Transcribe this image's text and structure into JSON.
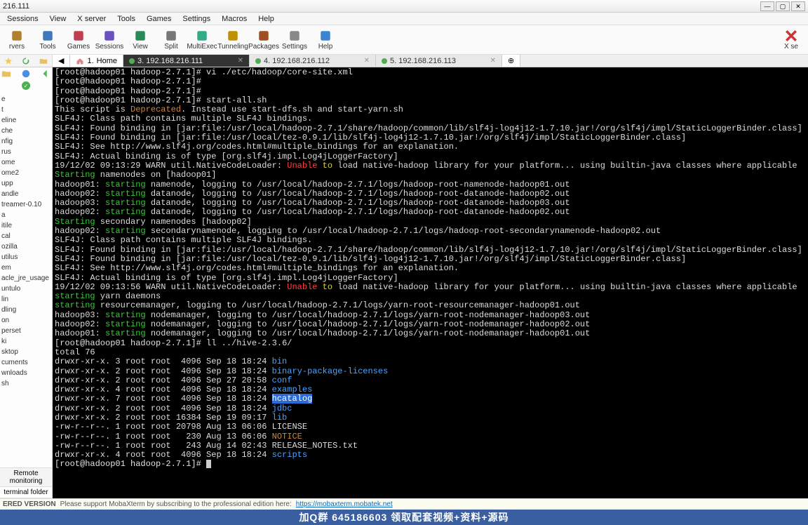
{
  "title_bar": {
    "title": "216.111"
  },
  "menu": {
    "items": [
      "Sessions",
      "View",
      "X server",
      "Tools",
      "Games",
      "Settings",
      "Macros",
      "Help"
    ]
  },
  "toolbar": {
    "items": [
      {
        "label": "rvers"
      },
      {
        "label": "Tools"
      },
      {
        "label": "Games"
      },
      {
        "label": "Sessions"
      },
      {
        "label": "View"
      },
      {
        "label": "Split"
      },
      {
        "label": "MultiExec"
      },
      {
        "label": "Tunneling"
      },
      {
        "label": "Packages"
      },
      {
        "label": "Settings"
      },
      {
        "label": "Help"
      }
    ],
    "right": {
      "label": "X se"
    }
  },
  "tabs": {
    "home": {
      "num": "1.",
      "label": "Home"
    },
    "list": [
      {
        "num": "3.",
        "label": "192.168.216.111",
        "active": true
      },
      {
        "num": "4.",
        "label": "192.168.216.112",
        "active": false
      },
      {
        "num": "5.",
        "label": "192.168.216.113",
        "active": false
      }
    ]
  },
  "sidebar": {
    "remote": "Remote\nmonitoring",
    "bottom": "terminal folder",
    "tree": [
      "e",
      "t",
      "eline",
      "che",
      "nfig",
      "rus",
      "ome",
      "ome2",
      "upp",
      "andle",
      "treamer-0.10",
      "a",
      "itile",
      "cal",
      "ozilla",
      "utilus",
      "em",
      "acle_jre_usage",
      "untulo",
      "lin",
      "dling",
      "on",
      "perset",
      "ki",
      "sktop",
      "cuments",
      "wnloads",
      "sh"
    ]
  },
  "terminal": {
    "lines": [
      {
        "seg": [
          {
            "t": "[root@hadoop01 hadoop-2.7.1]# ",
            "c": "pr"
          },
          {
            "t": "vi ./etc/hadoop/core-site.xml"
          }
        ]
      },
      {
        "seg": [
          {
            "t": "[root@hadoop01 hadoop-2.7.1]# ",
            "c": "pr"
          }
        ]
      },
      {
        "seg": [
          {
            "t": "[root@hadoop01 hadoop-2.7.1]# ",
            "c": "pr"
          }
        ]
      },
      {
        "seg": [
          {
            "t": "[root@hadoop01 hadoop-2.7.1]# ",
            "c": "pr"
          },
          {
            "t": "start-all.sh"
          }
        ]
      },
      {
        "seg": [
          {
            "t": "This script is "
          },
          {
            "t": "Deprecated",
            "c": "orange"
          },
          {
            "t": ". Instead use start-dfs.sh and start-yarn.sh"
          }
        ]
      },
      {
        "seg": [
          {
            "t": "SLF4J: Class path contains multiple SLF4J bindings."
          }
        ]
      },
      {
        "seg": [
          {
            "t": "SLF4J: Found binding in [jar:file:/usr/local/hadoop-2.7.1/share/hadoop/common/lib/slf4j-log4j12-1.7.10.jar!/org/slf4j/impl/StaticLoggerBinder.class]"
          }
        ]
      },
      {
        "seg": [
          {
            "t": "SLF4J: Found binding in [jar:file:/usr/local/tez-0.9.1/lib/slf4j-log4j12-1.7.10.jar!/org/slf4j/impl/StaticLoggerBinder.class]"
          }
        ]
      },
      {
        "seg": [
          {
            "t": "SLF4J: See http://www.slf4j.org/codes.html#multiple_bindings for an explanation."
          }
        ]
      },
      {
        "seg": [
          {
            "t": "SLF4J: Actual binding is of type [org.slf4j.impl.Log4jLoggerFactory]"
          }
        ]
      },
      {
        "seg": [
          {
            "t": "19/12/02 09:13:29 WARN util.NativeCodeLoader: "
          },
          {
            "t": "Unable",
            "c": "red"
          },
          {
            "t": " to",
            "c": "yel"
          },
          {
            "t": " load native-hadoop library for your platform... using builtin-java classes where applicable"
          }
        ]
      },
      {
        "seg": [
          {
            "t": "Starting",
            "c": "green"
          },
          {
            "t": " namenodes on [hadoop01]"
          }
        ]
      },
      {
        "seg": [
          {
            "t": "hadoop01: "
          },
          {
            "t": "starting",
            "c": "green"
          },
          {
            "t": " namenode, logging to /usr/local/hadoop-2.7.1/logs/hadoop-root-namenode-hadoop01.out"
          }
        ]
      },
      {
        "seg": [
          {
            "t": "hadoop02: "
          },
          {
            "t": "starting",
            "c": "green"
          },
          {
            "t": " datanode, logging to /usr/local/hadoop-2.7.1/logs/hadoop-root-datanode-hadoop02.out"
          }
        ]
      },
      {
        "seg": [
          {
            "t": "hadoop03: "
          },
          {
            "t": "starting",
            "c": "green"
          },
          {
            "t": " datanode, logging to /usr/local/hadoop-2.7.1/logs/hadoop-root-datanode-hadoop03.out"
          }
        ]
      },
      {
        "seg": [
          {
            "t": "hadoop02: "
          },
          {
            "t": "starting",
            "c": "green"
          },
          {
            "t": " datanode, logging to /usr/local/hadoop-2.7.1/logs/hadoop-root-datanode-hadoop02.out"
          }
        ]
      },
      {
        "seg": [
          {
            "t": "Starting",
            "c": "green"
          },
          {
            "t": " secondary namenodes [hadoop02]"
          }
        ]
      },
      {
        "seg": [
          {
            "t": "hadoop02: "
          },
          {
            "t": "starting",
            "c": "green"
          },
          {
            "t": " secondarynamenode, logging to /usr/local/hadoop-2.7.1/logs/hadoop-root-secondarynamenode-hadoop02.out"
          }
        ]
      },
      {
        "seg": [
          {
            "t": "SLF4J: Class path contains multiple SLF4J bindings."
          }
        ]
      },
      {
        "seg": [
          {
            "t": "SLF4J: Found binding in [jar:file:/usr/local/hadoop-2.7.1/share/hadoop/common/lib/slf4j-log4j12-1.7.10.jar!/org/slf4j/impl/StaticLoggerBinder.class]"
          }
        ]
      },
      {
        "seg": [
          {
            "t": "SLF4J: Found binding in [jar:file:/usr/local/tez-0.9.1/lib/slf4j-log4j12-1.7.10.jar!/org/slf4j/impl/StaticLoggerBinder.class]"
          }
        ]
      },
      {
        "seg": [
          {
            "t": "SLF4J: See http://www.slf4j.org/codes.html#multiple_bindings for an explanation."
          }
        ]
      },
      {
        "seg": [
          {
            "t": "SLF4J: Actual binding is of type [org.slf4j.impl.Log4jLoggerFactory]"
          }
        ]
      },
      {
        "seg": [
          {
            "t": "19/12/02 09:13:56 WARN util.NativeCodeLoader: "
          },
          {
            "t": "Unable",
            "c": "red"
          },
          {
            "t": " to",
            "c": "yel"
          },
          {
            "t": " load native-hadoop library for your platform... using builtin-java classes where applicable"
          }
        ]
      },
      {
        "seg": [
          {
            "t": "starting",
            "c": "green"
          },
          {
            "t": " yarn daemons"
          }
        ]
      },
      {
        "seg": [
          {
            "t": "starting",
            "c": "green"
          },
          {
            "t": " resourcemanager, logging to /usr/local/hadoop-2.7.1/logs/yarn-root-resourcemanager-hadoop01.out"
          }
        ]
      },
      {
        "seg": [
          {
            "t": "hadoop03: "
          },
          {
            "t": "starting",
            "c": "green"
          },
          {
            "t": " nodemanager, logging to /usr/local/hadoop-2.7.1/logs/yarn-root-nodemanager-hadoop03.out"
          }
        ]
      },
      {
        "seg": [
          {
            "t": "hadoop02: "
          },
          {
            "t": "starting",
            "c": "green"
          },
          {
            "t": " nodemanager, logging to /usr/local/hadoop-2.7.1/logs/yarn-root-nodemanager-hadoop02.out"
          }
        ]
      },
      {
        "seg": [
          {
            "t": "hadoop01: "
          },
          {
            "t": "starting",
            "c": "green"
          },
          {
            "t": " nodemanager, logging to /usr/local/hadoop-2.7.1/logs/yarn-root-nodemanager-hadoop01.out"
          }
        ]
      },
      {
        "seg": [
          {
            "t": "[root@hadoop01 hadoop-2.7.1]# ",
            "c": "pr"
          },
          {
            "t": "ll ../hive-2.3.6/"
          }
        ]
      },
      {
        "seg": [
          {
            "t": "total 76"
          }
        ]
      },
      {
        "seg": [
          {
            "t": "drwxr-xr-x. 3 root root  4096 Sep 18 18:24 "
          },
          {
            "t": "bin",
            "c": "blue"
          }
        ]
      },
      {
        "seg": [
          {
            "t": "drwxr-xr-x. 2 root root  4096 Sep 18 18:24 "
          },
          {
            "t": "binary-package-licenses",
            "c": "blue"
          }
        ]
      },
      {
        "seg": [
          {
            "t": "drwxr-xr-x. 2 root root  4096 Sep 27 20:58 "
          },
          {
            "t": "conf",
            "c": "blue"
          }
        ]
      },
      {
        "seg": [
          {
            "t": "drwxr-xr-x. 4 root root  4096 Sep 18 18:24 "
          },
          {
            "t": "examples",
            "c": "blue"
          }
        ]
      },
      {
        "seg": [
          {
            "t": "drwxr-xr-x. 7 root root  4096 Sep 18 18:24 "
          },
          {
            "t": "hcatalog",
            "c": "hl"
          }
        ]
      },
      {
        "seg": [
          {
            "t": "drwxr-xr-x. 2 root root  4096 Sep 18 18:24 "
          },
          {
            "t": "jdbc",
            "c": "blue"
          }
        ]
      },
      {
        "seg": [
          {
            "t": "drwxr-xr-x. 2 root root 16384 Sep 19 09:17 "
          },
          {
            "t": "lib",
            "c": "blue"
          }
        ]
      },
      {
        "seg": [
          {
            "t": "-rw-r--r--. 1 root root 20798 Aug 13 06:06 LICENSE"
          }
        ]
      },
      {
        "seg": [
          {
            "t": "-rw-r--r--. 1 root root   230 Aug 13 06:06 "
          },
          {
            "t": "NOTICE",
            "c": "orange"
          }
        ]
      },
      {
        "seg": [
          {
            "t": "-rw-r--r--. 1 root root   243 Aug 14 02:43 RELEASE_NOTES.txt"
          }
        ]
      },
      {
        "seg": [
          {
            "t": "drwxr-xr-x. 4 root root  4096 Sep 18 18:24 "
          },
          {
            "t": "scripts",
            "c": "blue"
          }
        ]
      },
      {
        "seg": [
          {
            "t": "[root@hadoop01 hadoop-2.7.1]# ",
            "c": "pr"
          },
          {
            "t": "",
            "cursor": true
          }
        ]
      }
    ]
  },
  "status": {
    "label": "ERED VERSION",
    "text": "Please support MobaXterm by subscribing to the professional edition here:",
    "link": "https://mobaxterm.mobatek.net"
  },
  "footer": "加Q群 645186603 领取配套视频+资料+源码"
}
